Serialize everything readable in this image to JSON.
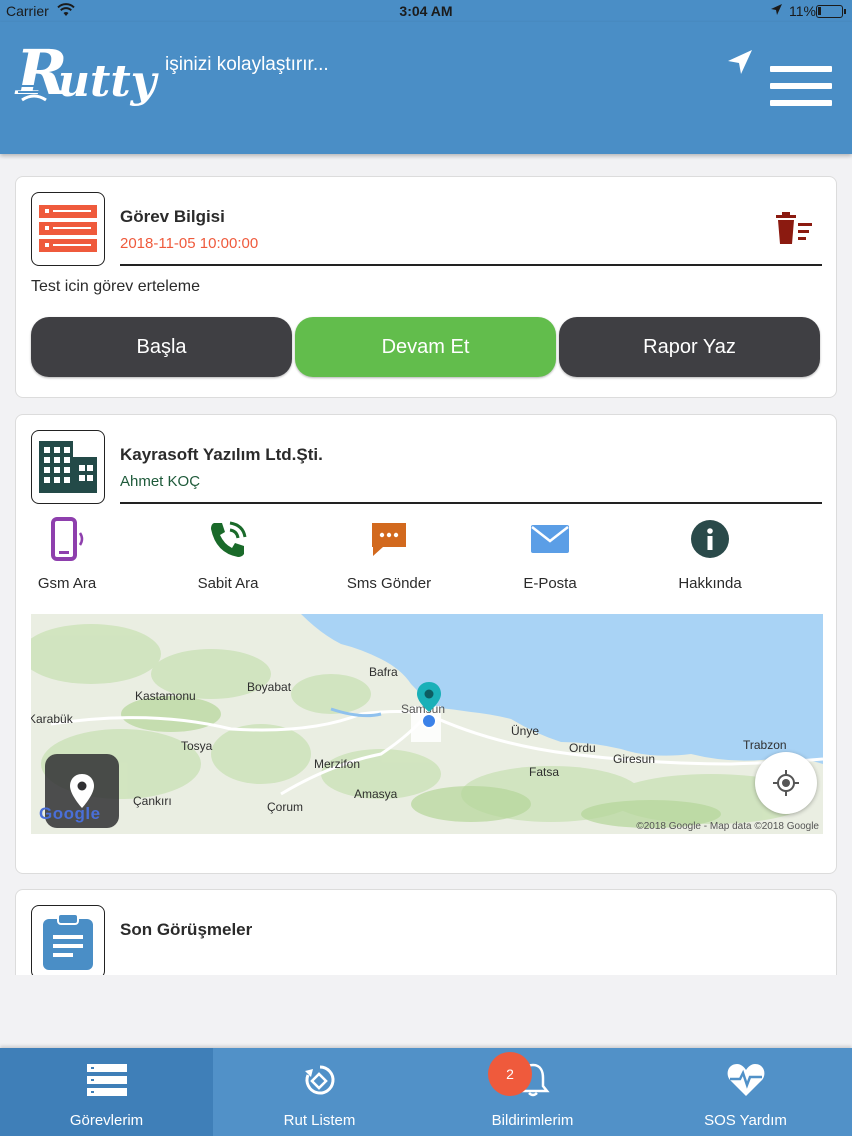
{
  "status_bar": {
    "carrier": "Carrier",
    "time": "3:04 AM",
    "battery": "11%"
  },
  "header": {
    "logo_text": "Rutty",
    "tagline": "işinizi kolaylaştırır..."
  },
  "task_card": {
    "title": "Görev Bilgisi",
    "datetime": "2018-11-05 10:00:00",
    "description": "Test icin görev erteleme",
    "buttons": {
      "start": "Başla",
      "continue": "Devam Et",
      "report": "Rapor Yaz"
    }
  },
  "company_card": {
    "name": "Kayrasoft Yazılım Ltd.Şti.",
    "contact": "Ahmet KOÇ",
    "actions": [
      {
        "label": "Gsm Ara",
        "icon": "mobile-phone-icon",
        "color": "#8e3fad"
      },
      {
        "label": "Sabit Ara",
        "icon": "phone-icon",
        "color": "#1a6a2a"
      },
      {
        "label": "Sms Gönder",
        "icon": "sms-icon",
        "color": "#d2691e"
      },
      {
        "label": "E-Posta",
        "icon": "email-icon",
        "color": "#5b9ee6"
      },
      {
        "label": "Hakkında",
        "icon": "info-icon",
        "color": "#2a4a4a"
      }
    ],
    "map": {
      "places": [
        "Bafra",
        "Kastamonu",
        "Boyabat",
        "Karabük",
        "Samsun",
        "Ünye",
        "Ordu",
        "Giresun",
        "Trabzon",
        "Tosya",
        "Merzifon",
        "Fatsa",
        "Amasya",
        "Çankırı",
        "Çorum"
      ],
      "logo": "Google",
      "credit": "©2018 Google - Map data ©2018 Google"
    }
  },
  "meetings_card": {
    "title": "Son Görüşmeler"
  },
  "tabbar": {
    "tabs": [
      {
        "label": "Görevlerim",
        "icon": "tasks-icon"
      },
      {
        "label": "Rut Listem",
        "icon": "route-icon"
      },
      {
        "label": "Bildirimlerim",
        "icon": "bell-icon"
      },
      {
        "label": "SOS Yardım",
        "icon": "heartbeat-icon"
      }
    ],
    "badge": "2"
  },
  "colors": {
    "primary": "#4a8ec6",
    "green": "#62bd4c",
    "dark_button": "#3f3f43",
    "accent_red": "#ef5a3c"
  }
}
